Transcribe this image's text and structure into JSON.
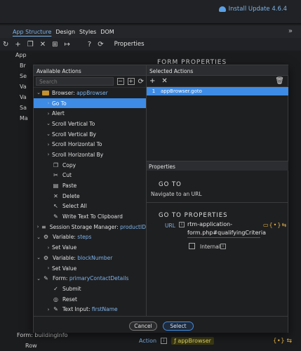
{
  "topbar": {
    "update_label": "Install Update 4.6.4"
  },
  "menubar": {
    "items": [
      "App Structure",
      "Design",
      "Styles",
      "DOM"
    ],
    "chevron": "»"
  },
  "toolbar": {
    "properties_label": "Properties"
  },
  "background": {
    "tree": [
      "App",
      "Br",
      "Se",
      "Va",
      "Va",
      "Sa",
      "Ma"
    ],
    "right_header": "FORM PROPERTIES",
    "bottom_item1": "Form: buildingInfo",
    "bottom_item2": "Row",
    "action_label": "Action",
    "action_value": "ƒ appBrowser"
  },
  "dialog": {
    "left_title": "Available Actions",
    "search_placeholder": "Search",
    "tree": [
      {
        "label": "Browser: ",
        "suffix": "appBrowser",
        "indent": 0,
        "toggle": "v",
        "icon": "box",
        "selected": false
      },
      {
        "label": "Go To",
        "suffix": "",
        "indent": 1,
        "toggle": ">",
        "icon": "",
        "selected": true
      },
      {
        "label": "Alert",
        "suffix": "",
        "indent": 1,
        "toggle": ">",
        "icon": "",
        "selected": false
      },
      {
        "label": "Scroll Vertical To",
        "suffix": "",
        "indent": 1,
        "toggle": "v",
        "icon": "",
        "selected": false
      },
      {
        "label": "Scroll Vertical By",
        "suffix": "",
        "indent": 1,
        "toggle": "v",
        "icon": "",
        "selected": false
      },
      {
        "label": "Scroll Horizontal To",
        "suffix": "",
        "indent": 1,
        "toggle": ">",
        "icon": "",
        "selected": false
      },
      {
        "label": "Scroll Horizontal By",
        "suffix": "",
        "indent": 1,
        "toggle": ">",
        "icon": "",
        "selected": false
      },
      {
        "label": "Copy",
        "suffix": "",
        "indent": 1,
        "toggle": "",
        "icon": "❐",
        "selected": false
      },
      {
        "label": "Cut",
        "suffix": "",
        "indent": 1,
        "toggle": "",
        "icon": "✂",
        "selected": false
      },
      {
        "label": "Paste",
        "suffix": "",
        "indent": 1,
        "toggle": "",
        "icon": "▤",
        "selected": false
      },
      {
        "label": "Delete",
        "suffix": "",
        "indent": 1,
        "toggle": "",
        "icon": "✕",
        "selected": false
      },
      {
        "label": "Select All",
        "suffix": "",
        "indent": 1,
        "toggle": "",
        "icon": "↖",
        "selected": false
      },
      {
        "label": "Write Text To Clipboard",
        "suffix": "",
        "indent": 1,
        "toggle": "",
        "icon": "✎",
        "selected": false
      },
      {
        "label": "Session Storage Manager: ",
        "suffix": "productID",
        "indent": 0,
        "toggle": ">",
        "icon": "≡",
        "selected": false
      },
      {
        "label": "Variable: ",
        "suffix": "steps",
        "indent": 0,
        "toggle": "v",
        "icon": "⚙",
        "selected": false
      },
      {
        "label": "Set Value",
        "suffix": "",
        "indent": 1,
        "toggle": ">",
        "icon": "",
        "selected": false
      },
      {
        "label": "Variable: ",
        "suffix": "blockNumber",
        "indent": 0,
        "toggle": "v",
        "icon": "⚙",
        "selected": false
      },
      {
        "label": "Set Value",
        "suffix": "",
        "indent": 1,
        "toggle": ">",
        "icon": "",
        "selected": false
      },
      {
        "label": "Form: ",
        "suffix": "primaryContactDetails",
        "indent": 0,
        "toggle": "v",
        "icon": "✎",
        "selected": false
      },
      {
        "label": "Submit",
        "suffix": "",
        "indent": 1,
        "toggle": "",
        "icon": "✓",
        "selected": false
      },
      {
        "label": "Reset",
        "suffix": "",
        "indent": 1,
        "toggle": "",
        "icon": "◎",
        "selected": false
      },
      {
        "label": "Text Input: ",
        "suffix": "firstName",
        "indent": 1,
        "toggle": ">",
        "icon": "✎",
        "selected": false
      }
    ],
    "right_title": "Selected Actions",
    "selected_actions": [
      {
        "num": "1",
        "label": "appBrowser.goto"
      }
    ],
    "properties": {
      "title": "Properties",
      "heading": "GO TO",
      "description": "Navigate to an URL",
      "props_heading": "GO TO PROPERTIES",
      "url_label": "URL",
      "url_value": "rtm-application-form.php#qualifyingCriteria",
      "internal_label": "Internal",
      "info": "i"
    },
    "buttons": {
      "cancel": "Cancel",
      "select": "Select"
    }
  }
}
